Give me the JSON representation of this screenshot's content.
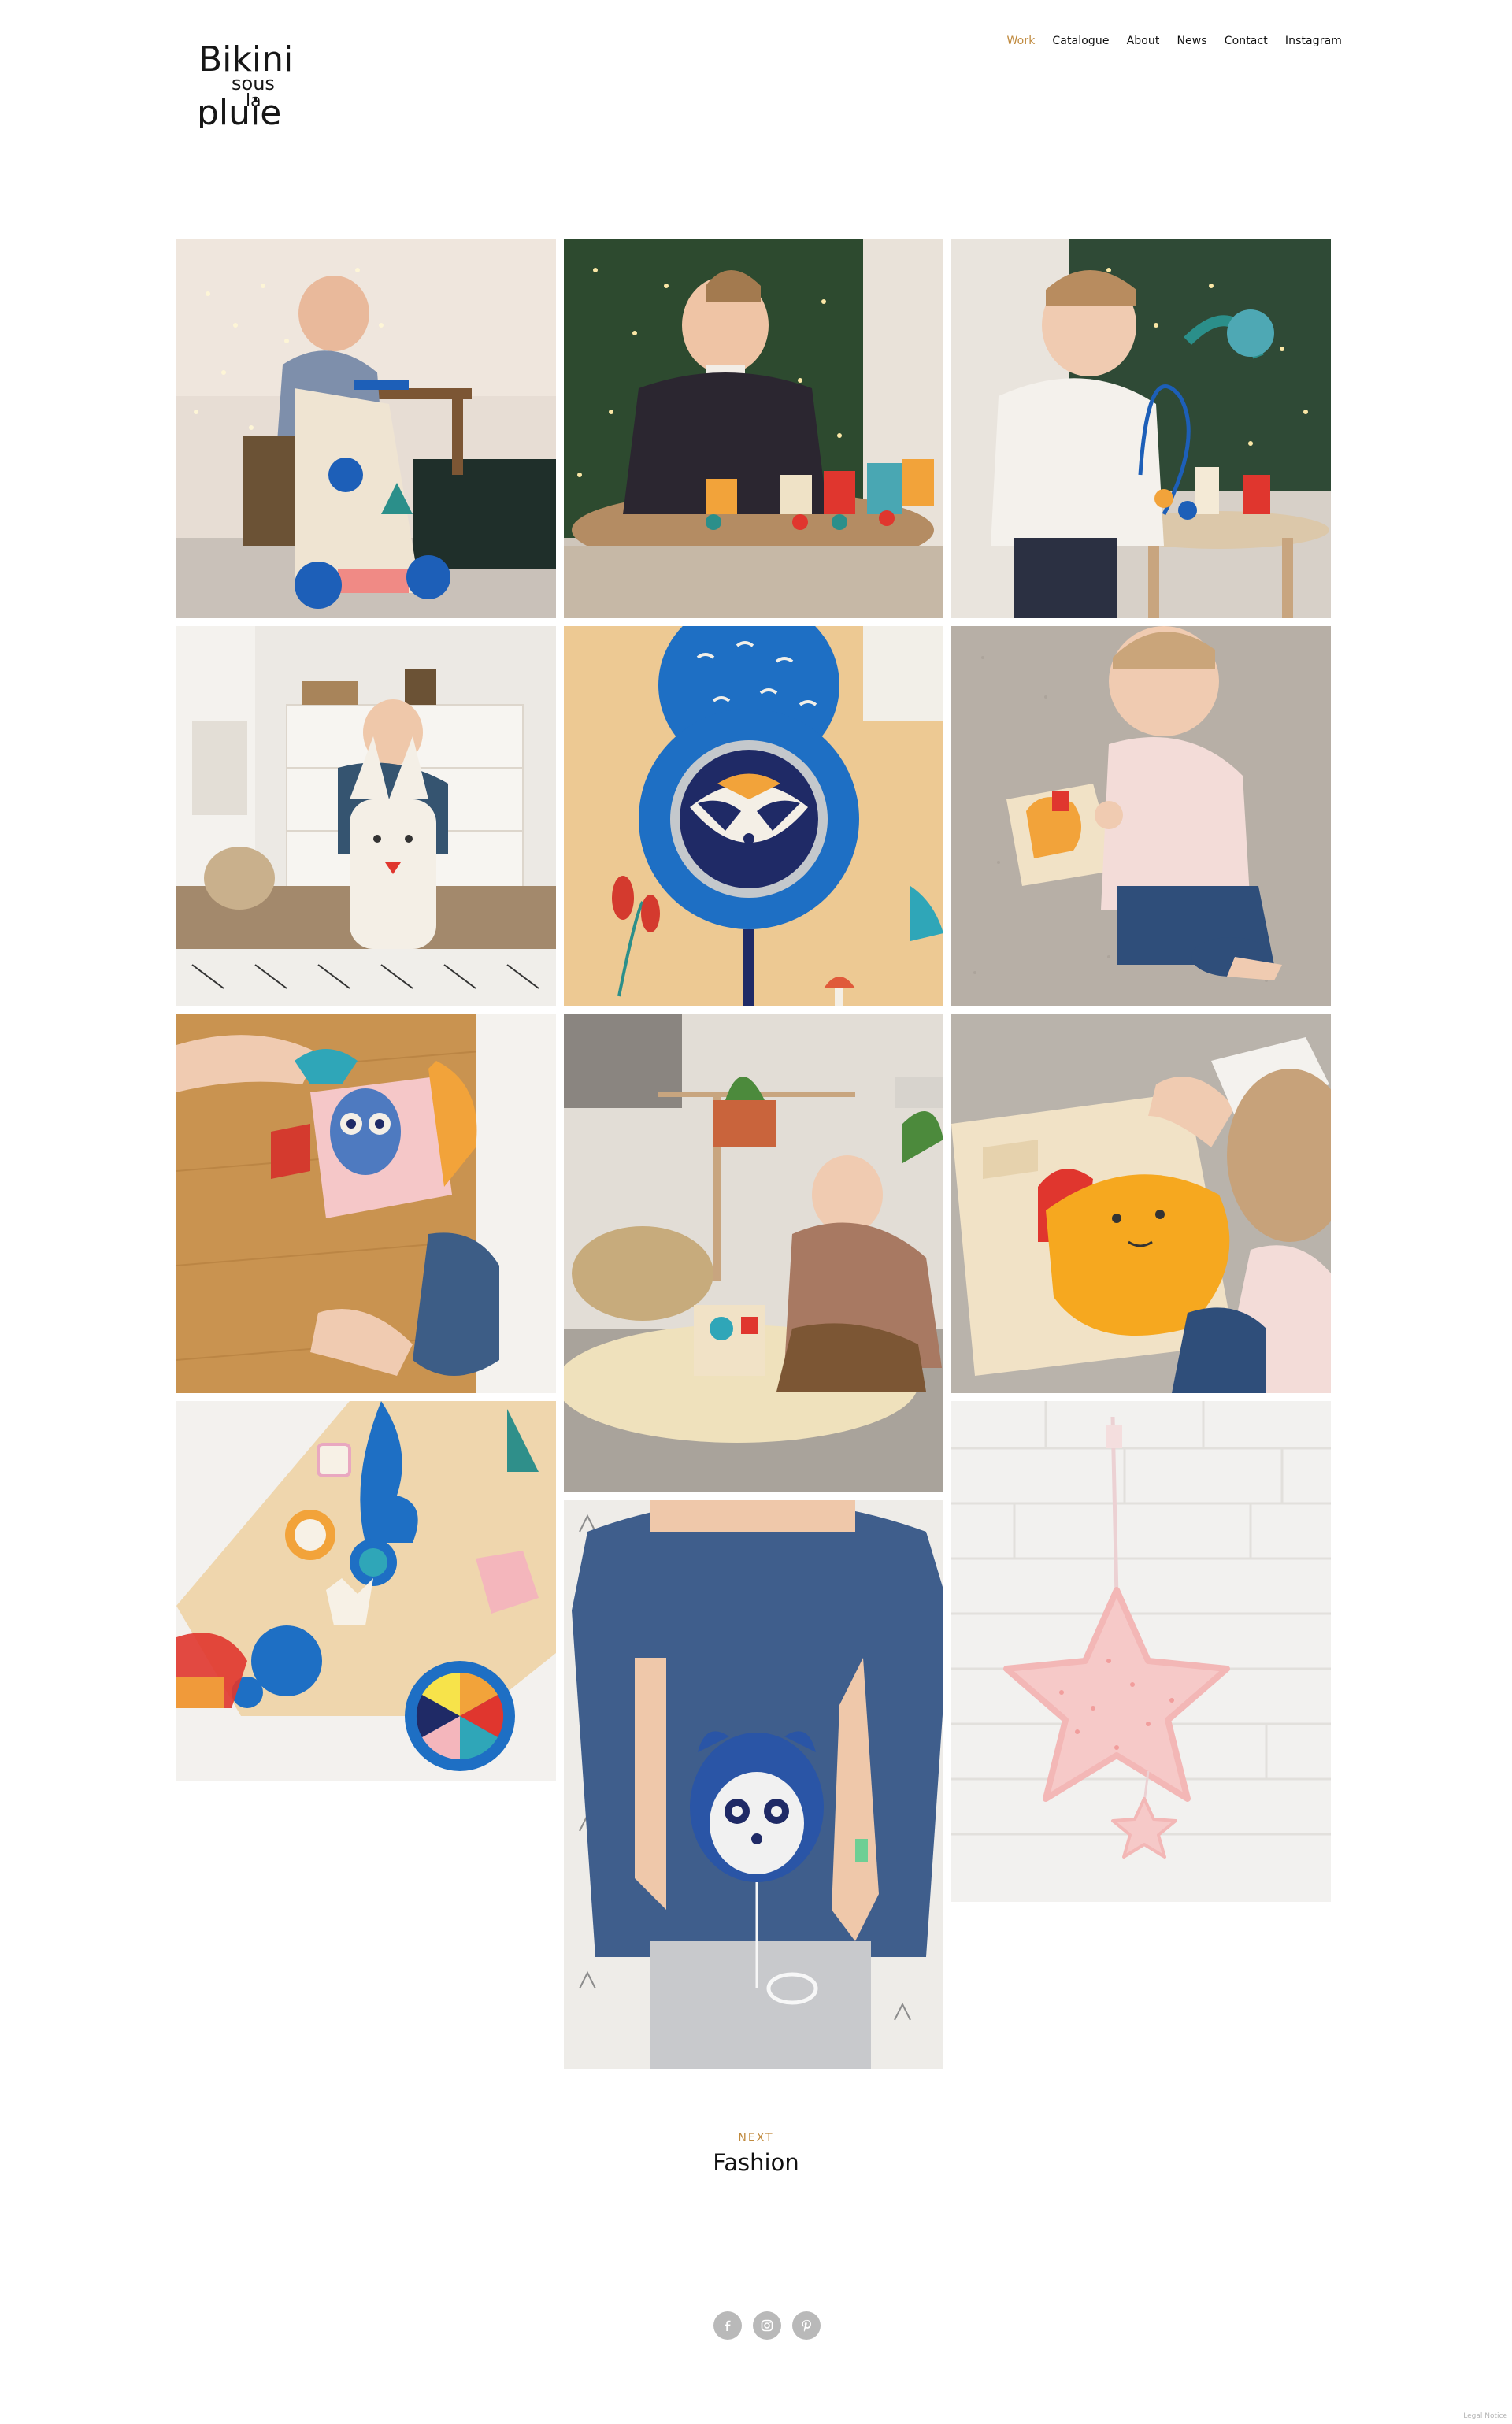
{
  "brand": {
    "logo_text": "Bikini sous la pluie",
    "logo_lines": [
      "Bikini",
      "sous",
      "la",
      "pluie"
    ]
  },
  "nav": {
    "items": [
      {
        "label": "Work",
        "active": true
      },
      {
        "label": "Catalogue",
        "active": false
      },
      {
        "label": "About",
        "active": false
      },
      {
        "label": "News",
        "active": false
      },
      {
        "label": "Contact",
        "active": false
      },
      {
        "label": "Instagram",
        "active": false
      }
    ]
  },
  "gallery": {
    "photos": [
      {
        "subject": "baby with wooden activity walker"
      },
      {
        "subject": "toddler with wooden animal train by christmas tree"
      },
      {
        "subject": "baby with bead maze activity table"
      },
      {
        "subject": "child on rabbit ride-on toy in bedroom"
      },
      {
        "subject": "raccoon mirror detail on walker"
      },
      {
        "subject": "baby with wooden puzzle on carpet"
      },
      {
        "subject": "baby holding soft activity cube with owl"
      },
      {
        "subject": "baby playing with activity cube on play mat"
      },
      {
        "subject": "hand placing pieces in wooden bear puzzle"
      },
      {
        "subject": "close-up of walker wheels and shape holes"
      },
      {
        "subject": "child holding raccoon musical plush"
      },
      {
        "subject": "pink star musical mobile on white brick wall"
      }
    ]
  },
  "next_project": {
    "label": "NEXT",
    "title": "Fashion"
  },
  "social": [
    {
      "icon": "facebook-icon"
    },
    {
      "icon": "instagram-icon"
    },
    {
      "icon": "pinterest-icon"
    }
  ],
  "footer": {
    "legal": "Legal Notice"
  },
  "colors": {
    "accent": "#c08a3e",
    "text": "#111111",
    "social_bg": "#b9b9b9"
  }
}
